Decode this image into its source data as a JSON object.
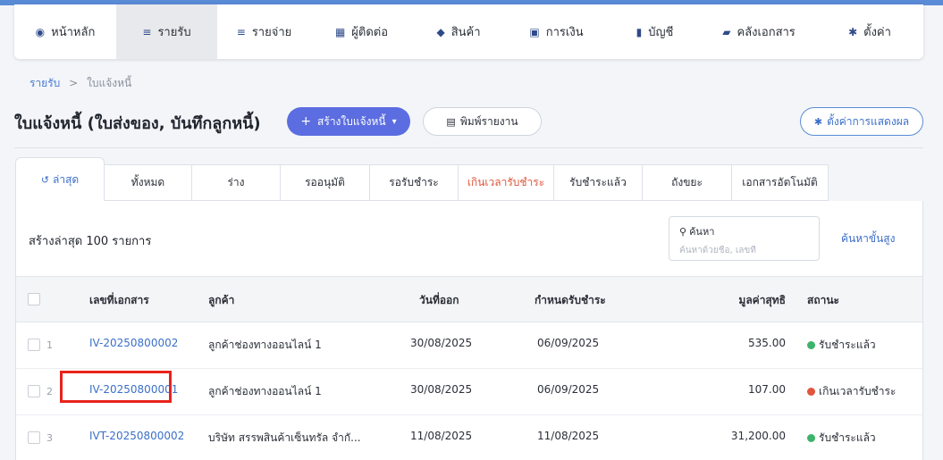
{
  "nav": {
    "items": [
      {
        "label": "หน้าหลัก",
        "icon": "dashboard-icon",
        "glyph": "◉"
      },
      {
        "label": "รายรับ",
        "icon": "income-icon",
        "glyph": "≡",
        "active": true
      },
      {
        "label": "รายจ่าย",
        "icon": "expense-icon",
        "glyph": "≡"
      },
      {
        "label": "ผู้ติดต่อ",
        "icon": "contacts-icon",
        "glyph": "▦"
      },
      {
        "label": "สินค้า",
        "icon": "box-icon",
        "glyph": "◆"
      },
      {
        "label": "การเงิน",
        "icon": "money-icon",
        "glyph": "▣"
      },
      {
        "label": "บัญชี",
        "icon": "book-icon",
        "glyph": "▮"
      },
      {
        "label": "คลังเอกสาร",
        "icon": "folder-icon",
        "glyph": "▰"
      },
      {
        "label": "ตั้งค่า",
        "icon": "gear-icon",
        "glyph": "✱"
      }
    ]
  },
  "breadcrumb": {
    "root": "รายรับ",
    "separator": ">",
    "current": "ใบแจ้งหนี้"
  },
  "page": {
    "title": "ใบแจ้งหนี้ (ใบส่งของ, บันทึกลูกหนี้)",
    "create_button": "สร้างใบแจ้งหนี้",
    "print_button": "พิมพ์รายงาน",
    "settings_button": "ตั้งค่าการแสดงผล"
  },
  "tabs": [
    {
      "label": "ล่าสุด",
      "active": true
    },
    {
      "label": "ทั้งหมด"
    },
    {
      "label": "ร่าง"
    },
    {
      "label": "รออนุมัติ"
    },
    {
      "label": "รอรับชำระ"
    },
    {
      "label": "เกินเวลารับชำระ",
      "overdue": true
    },
    {
      "label": "รับชำระแล้ว"
    },
    {
      "label": "ถังขยะ"
    },
    {
      "label": "เอกสารอัตโนมัติ"
    }
  ],
  "list": {
    "title": "สร้างล่าสุด 100 รายการ",
    "search_label": "ค้นหา",
    "search_placeholder": "ค้นหาด้วยชื่อ, เลขที่",
    "advanced_search": "ค้นหาขั้นสูง"
  },
  "table": {
    "headers": {
      "doc_no": "เลขที่เอกสาร",
      "customer": "ลูกค้า",
      "issue_date": "วันที่ออก",
      "due_date": "กำหนดรับชำระ",
      "net_value": "มูลค่าสุทธิ",
      "status": "สถานะ"
    },
    "rows": [
      {
        "num": "1",
        "doc_no": "IV-20250800002",
        "customer": "ลูกค้าช่องทางออนไลน์ 1",
        "issue_date": "30/08/2025",
        "due_date": "06/09/2025",
        "net_value": "535.00",
        "status": "รับชำระแล้ว",
        "status_color": "#3db36b"
      },
      {
        "num": "2",
        "doc_no": "IV-20250800001",
        "customer": "ลูกค้าช่องทางออนไลน์ 1",
        "issue_date": "30/08/2025",
        "due_date": "06/09/2025",
        "net_value": "107.00",
        "status": "เกินเวลารับชำระ",
        "status_color": "#e0553c"
      },
      {
        "num": "3",
        "doc_no": "IVT-20250800002",
        "customer": "บริษัท สรรพสินค้าเซ็นทรัล จำกั...",
        "issue_date": "11/08/2025",
        "due_date": "11/08/2025",
        "net_value": "31,200.00",
        "status": "รับชำระแล้ว",
        "status_color": "#3db36b"
      }
    ]
  },
  "colors": {
    "accent": "#5b6de0",
    "link": "#3b6fc8",
    "paid": "#3db36b",
    "overdue": "#e0553c",
    "highlight": "#e8231c"
  }
}
